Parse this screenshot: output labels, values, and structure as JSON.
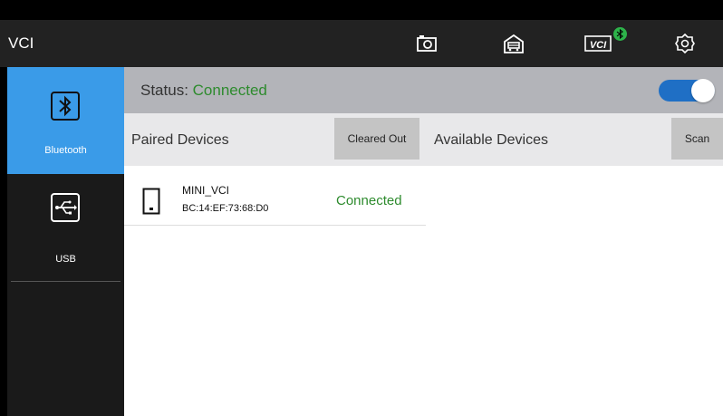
{
  "header": {
    "title": "VCI",
    "icons": [
      "camera-icon",
      "garage-icon",
      "vci-bluetooth-icon",
      "settings-icon"
    ],
    "vci_label": "VCI"
  },
  "sidebar": {
    "items": [
      {
        "label": "Bluetooth",
        "icon": "bluetooth-icon",
        "active": true
      },
      {
        "label": "USB",
        "icon": "usb-icon",
        "active": false
      }
    ]
  },
  "status": {
    "label": "Status: ",
    "value": "Connected",
    "toggle_on": true
  },
  "paired": {
    "title": "Paired Devices",
    "clear_label": "Cleared Out",
    "devices": [
      {
        "name": "MINI_VCI",
        "mac": "BC:14:EF:73:68:D0",
        "status": "Connected"
      }
    ]
  },
  "available": {
    "title": "Available Devices",
    "scan_label": "Scan"
  },
  "colors": {
    "accent": "#3a9be8",
    "connected": "#2e8b2e",
    "toggle": "#1f6fc5",
    "bt_badge": "#2db34a"
  }
}
